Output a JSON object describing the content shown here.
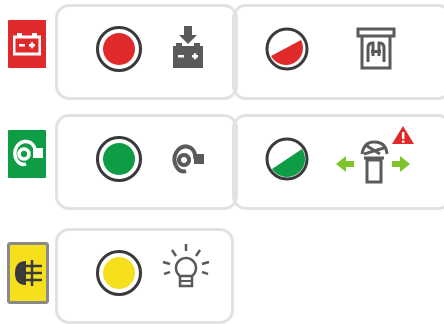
{
  "colors": {
    "red": "#e0292b",
    "green": "#0e9c45",
    "yellow": "#f6df1c",
    "yellow_border": "#8a8a8a",
    "outline": "#3a3a3a",
    "card_border": "#e2e2e2",
    "arrow_green": "#7ec42a",
    "warning_red": "#e0292b",
    "icon_gray": "#5a5a5a"
  },
  "rows": [
    {
      "name": "battery",
      "tile_icon": "battery-icon",
      "status_color": "red",
      "detail_icon": "battery-charging-icon",
      "gauge_fill": 0.35,
      "gauge_color": "red",
      "extra_icon": "fuse-box-icon"
    },
    {
      "name": "horn",
      "tile_icon": "horn-icon",
      "status_color": "green",
      "detail_icon": "horn-small-icon",
      "gauge_fill": 0.5,
      "gauge_color": "green",
      "extra_icon": "steering-column-warning-icon"
    },
    {
      "name": "fog-light",
      "tile_icon": "rear-fog-light-icon",
      "status_color": "yellow",
      "detail_icon": "light-bulb-icon"
    }
  ]
}
